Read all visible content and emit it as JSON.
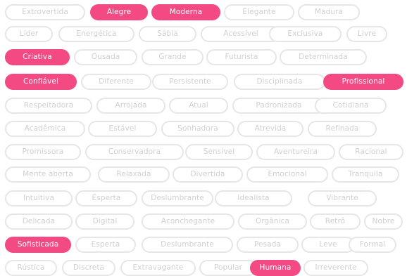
{
  "rows": [
    {
      "tags": [
        {
          "label": "Extrovertida",
          "selected": false
        },
        {
          "label": "Alegre",
          "selected": true
        },
        {
          "label": "Moderna",
          "selected": true
        },
        {
          "label": "Elegante",
          "selected": false
        },
        {
          "label": "Madura",
          "selected": false
        }
      ]
    },
    {
      "tags": [
        {
          "label": "Líder",
          "selected": false
        },
        {
          "label": "Energética",
          "selected": false
        },
        {
          "label": "Sábia",
          "selected": false
        },
        {
          "label": "Acessível",
          "selected": false
        },
        {
          "label": "Exclusiva",
          "selected": false
        },
        {
          "label": "Livre",
          "selected": false
        }
      ]
    },
    {
      "tags": [
        {
          "label": "Criativa",
          "selected": true
        },
        {
          "label": "Ousada",
          "selected": false
        },
        {
          "label": "Grande",
          "selected": false
        },
        {
          "label": "Futurista",
          "selected": false
        },
        {
          "label": "Determinada",
          "selected": false
        }
      ]
    },
    {
      "tags": [
        {
          "label": "Confiável",
          "selected": true
        },
        {
          "label": "Diferente",
          "selected": false
        },
        {
          "label": "Persistente",
          "selected": false
        },
        {
          "label": "Disciplinada",
          "selected": false
        },
        {
          "label": "Profissional",
          "selected": true
        }
      ]
    },
    {
      "tags": [
        {
          "label": "Respeitadora",
          "selected": false
        },
        {
          "label": "Arrojada",
          "selected": false
        },
        {
          "label": "Atual",
          "selected": false
        },
        {
          "label": "Padronizada",
          "selected": false
        },
        {
          "label": "Cotidiana",
          "selected": false
        }
      ]
    },
    {
      "tags": [
        {
          "label": "Acadêmica",
          "selected": false
        },
        {
          "label": "Estável",
          "selected": false
        },
        {
          "label": "Sonhadora",
          "selected": false
        },
        {
          "label": "Atrevida",
          "selected": false
        },
        {
          "label": "Refinada",
          "selected": false
        }
      ]
    },
    {
      "tags": [
        {
          "label": "Promissora",
          "selected": false
        },
        {
          "label": "Conservadora",
          "selected": false
        },
        {
          "label": "Sensível",
          "selected": false
        },
        {
          "label": "Aventureira",
          "selected": false
        },
        {
          "label": "Racional",
          "selected": false
        }
      ]
    },
    {
      "tags": [
        {
          "label": "Mente aberta",
          "selected": false
        },
        {
          "label": "Relaxada",
          "selected": false
        },
        {
          "label": "Divertida",
          "selected": false
        },
        {
          "label": "Emocional",
          "selected": false
        },
        {
          "label": "Tranquila",
          "selected": false
        }
      ]
    },
    {
      "tags": [
        {
          "label": "Intuitiva",
          "selected": false
        },
        {
          "label": "Esperta",
          "selected": false
        },
        {
          "label": "Deslumbrante",
          "selected": false
        },
        {
          "label": "Idealista",
          "selected": false
        },
        {
          "label": "Vibrante",
          "selected": false
        }
      ]
    },
    {
      "tags": [
        {
          "label": "Delicada",
          "selected": false
        },
        {
          "label": "Digital",
          "selected": false
        },
        {
          "label": "Aconchegante",
          "selected": false
        },
        {
          "label": "Orgânica",
          "selected": false
        },
        {
          "label": "Retrô",
          "selected": false
        },
        {
          "label": "Nobre",
          "selected": false
        }
      ]
    },
    {
      "tags": [
        {
          "label": "Sofisticada",
          "selected": true
        },
        {
          "label": "Esperta",
          "selected": false
        },
        {
          "label": "Deslumbrante",
          "selected": false
        },
        {
          "label": "Pesada",
          "selected": false
        },
        {
          "label": "Leve",
          "selected": false
        },
        {
          "label": "Formal",
          "selected": false
        }
      ]
    },
    {
      "tags": [
        {
          "label": "Rústica",
          "selected": false
        },
        {
          "label": "Discreta",
          "selected": false
        },
        {
          "label": "Extravagante",
          "selected": false
        },
        {
          "label": "Popular",
          "selected": false
        },
        {
          "label": "Humana",
          "selected": true
        },
        {
          "label": "Irreverente",
          "selected": false
        }
      ]
    }
  ]
}
